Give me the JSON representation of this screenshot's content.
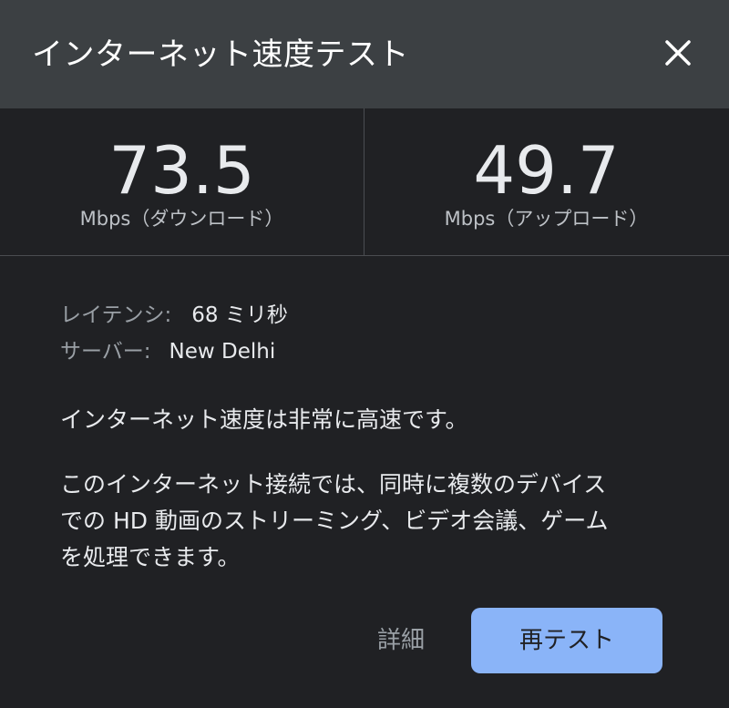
{
  "dialog": {
    "title": "インターネット速度テスト",
    "close_icon": "close-icon"
  },
  "speeds": {
    "download": {
      "value": "73.5",
      "unit": "Mbps（ダウンロード）"
    },
    "upload": {
      "value": "49.7",
      "unit": "Mbps（アップロード）"
    }
  },
  "info": {
    "latency_label": "レイテンシ:",
    "latency_value": "68 ミリ秒",
    "server_label": "サーバー:",
    "server_value": "New Delhi"
  },
  "message": "インターネット速度は非常に高速です。",
  "description": [
    "このインターネット接続では、同時に複数のデバイス",
    "での HD 動画のストリーミング、ビデオ会議、ゲーム",
    "を処理できます。"
  ],
  "buttons": {
    "details": "詳細",
    "retest": "再テスト"
  },
  "colors": {
    "header_bg": "#3c4043",
    "body_bg": "#202124",
    "accent": "#8ab4f8",
    "muted_text": "#9aa0a6"
  }
}
